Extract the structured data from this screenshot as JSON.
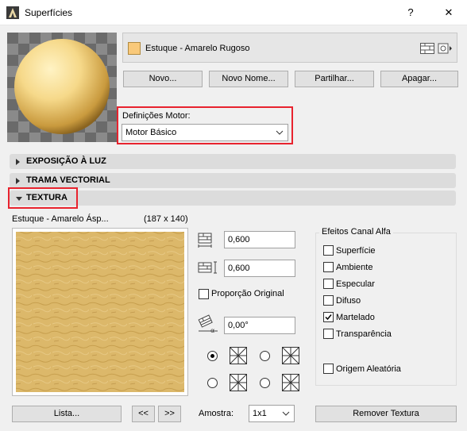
{
  "window": {
    "title": "Superfícies",
    "help": "?",
    "close": "✕"
  },
  "material": {
    "name": "Estuque - Amarelo Rugoso",
    "swatch_color": "#f9c97a"
  },
  "buttons": {
    "new": "Novo...",
    "rename": "Novo Nome...",
    "share": "Partilhar...",
    "delete": "Apagar..."
  },
  "engine": {
    "label": "Definições Motor:",
    "value": "Motor Básico"
  },
  "sections": {
    "exposure": "EXPOSIÇÃO À LUZ",
    "vector_hatch": "TRAMA VECTORIAL",
    "texture": "TEXTURA"
  },
  "texture": {
    "name": "Estuque - Amarelo Ásp...",
    "size": "(187 x 140)",
    "width": "0,600",
    "height": "0,600",
    "keep_ratio_label": "Proporção Original",
    "angle": "0,00°",
    "list_button": "Lista...",
    "prev": "<<",
    "next": ">>",
    "sample_label": "Amostra:",
    "sample_value": "1x1",
    "remove_button": "Remover Textura"
  },
  "alpha": {
    "title": "Efeitos Canal Alfa",
    "items": [
      {
        "label": "Superfície",
        "checked": false
      },
      {
        "label": "Ambiente",
        "checked": false
      },
      {
        "label": "Especular",
        "checked": false
      },
      {
        "label": "Difuso",
        "checked": false
      },
      {
        "label": "Martelado",
        "checked": true
      },
      {
        "label": "Transparência",
        "checked": false
      }
    ],
    "random_origin": "Origem Aleatória"
  },
  "colors": {
    "highlight": "#e8232e",
    "texture_fill": "#dcb86a"
  }
}
